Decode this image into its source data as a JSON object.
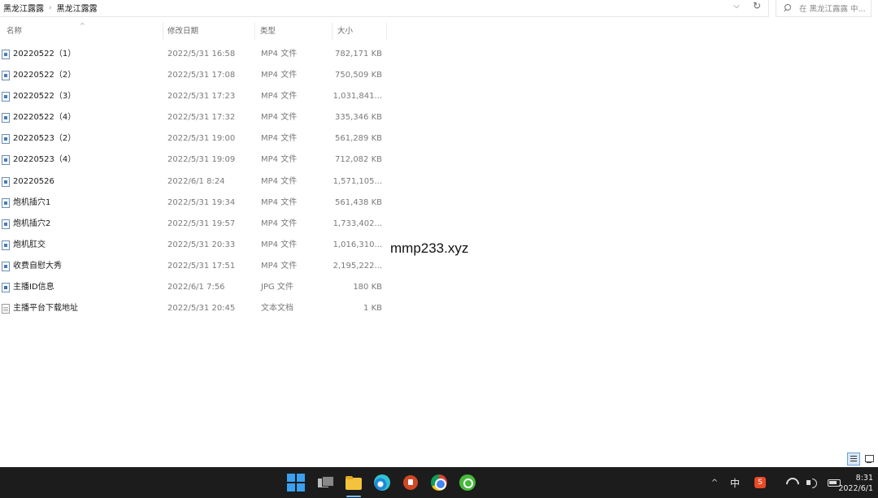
{
  "address_bar": {
    "breadcrumbs": [
      "黑龙江露露",
      "黑龙江露露"
    ],
    "separator": "›",
    "dropdown_icon": "chevron-down-icon",
    "refresh_icon": "refresh-icon"
  },
  "search": {
    "placeholder": "在 黑龙江露露 中...",
    "icon": "search-icon"
  },
  "columns": {
    "name": "名称",
    "date": "修改日期",
    "type": "类型",
    "size": "大小",
    "sort_indicator": "^"
  },
  "files": [
    {
      "name": "20220522（1）",
      "date": "2022/5/31 16:58",
      "type": "MP4 文件",
      "size": "782,171 KB",
      "icon": "video-file-icon"
    },
    {
      "name": "20220522（2）",
      "date": "2022/5/31 17:08",
      "type": "MP4 文件",
      "size": "750,509 KB",
      "icon": "video-file-icon"
    },
    {
      "name": "20220522（3）",
      "date": "2022/5/31 17:23",
      "type": "MP4 文件",
      "size": "1,031,841...",
      "icon": "video-file-icon"
    },
    {
      "name": "20220522（4）",
      "date": "2022/5/31 17:32",
      "type": "MP4 文件",
      "size": "335,346 KB",
      "icon": "video-file-icon"
    },
    {
      "name": "20220523（2）",
      "date": "2022/5/31 19:00",
      "type": "MP4 文件",
      "size": "561,289 KB",
      "icon": "video-file-icon"
    },
    {
      "name": "20220523（4）",
      "date": "2022/5/31 19:09",
      "type": "MP4 文件",
      "size": "712,082 KB",
      "icon": "video-file-icon"
    },
    {
      "name": "20220526",
      "date": "2022/6/1 8:24",
      "type": "MP4 文件",
      "size": "1,571,105...",
      "icon": "video-file-icon"
    },
    {
      "name": "炮机插穴1",
      "date": "2022/5/31 19:34",
      "type": "MP4 文件",
      "size": "561,438 KB",
      "icon": "video-file-icon"
    },
    {
      "name": "炮机插穴2",
      "date": "2022/5/31 19:57",
      "type": "MP4 文件",
      "size": "1,733,402...",
      "icon": "video-file-icon"
    },
    {
      "name": "炮机肛交",
      "date": "2022/5/31 20:33",
      "type": "MP4 文件",
      "size": "1,016,310...",
      "icon": "video-file-icon"
    },
    {
      "name": "收费自慰大秀",
      "date": "2022/5/31 17:51",
      "type": "MP4 文件",
      "size": "2,195,222...",
      "icon": "video-file-icon"
    },
    {
      "name": "主播ID信息",
      "date": "2022/6/1 7:56",
      "type": "JPG 文件",
      "size": "180 KB",
      "icon": "image-file-icon"
    },
    {
      "name": "主播平台下载地址",
      "date": "2022/5/31 20:45",
      "type": "文本文档",
      "size": "1 KB",
      "icon": "text-file-icon"
    }
  ],
  "watermark": "mmp233.xyz",
  "view_toggles": [
    "details-view-icon",
    "tiles-view-icon"
  ],
  "taskbar": {
    "apps": [
      "windows-start-icon",
      "task-view-icon",
      "file-explorer-icon",
      "edge-icon",
      "powerpoint-icon",
      "chrome-icon",
      "browser-icon"
    ],
    "tray": {
      "chevron": "^",
      "ime": "中",
      "sogou": "S"
    },
    "clock": {
      "time": "8:31",
      "date": "2022/6/1"
    }
  }
}
